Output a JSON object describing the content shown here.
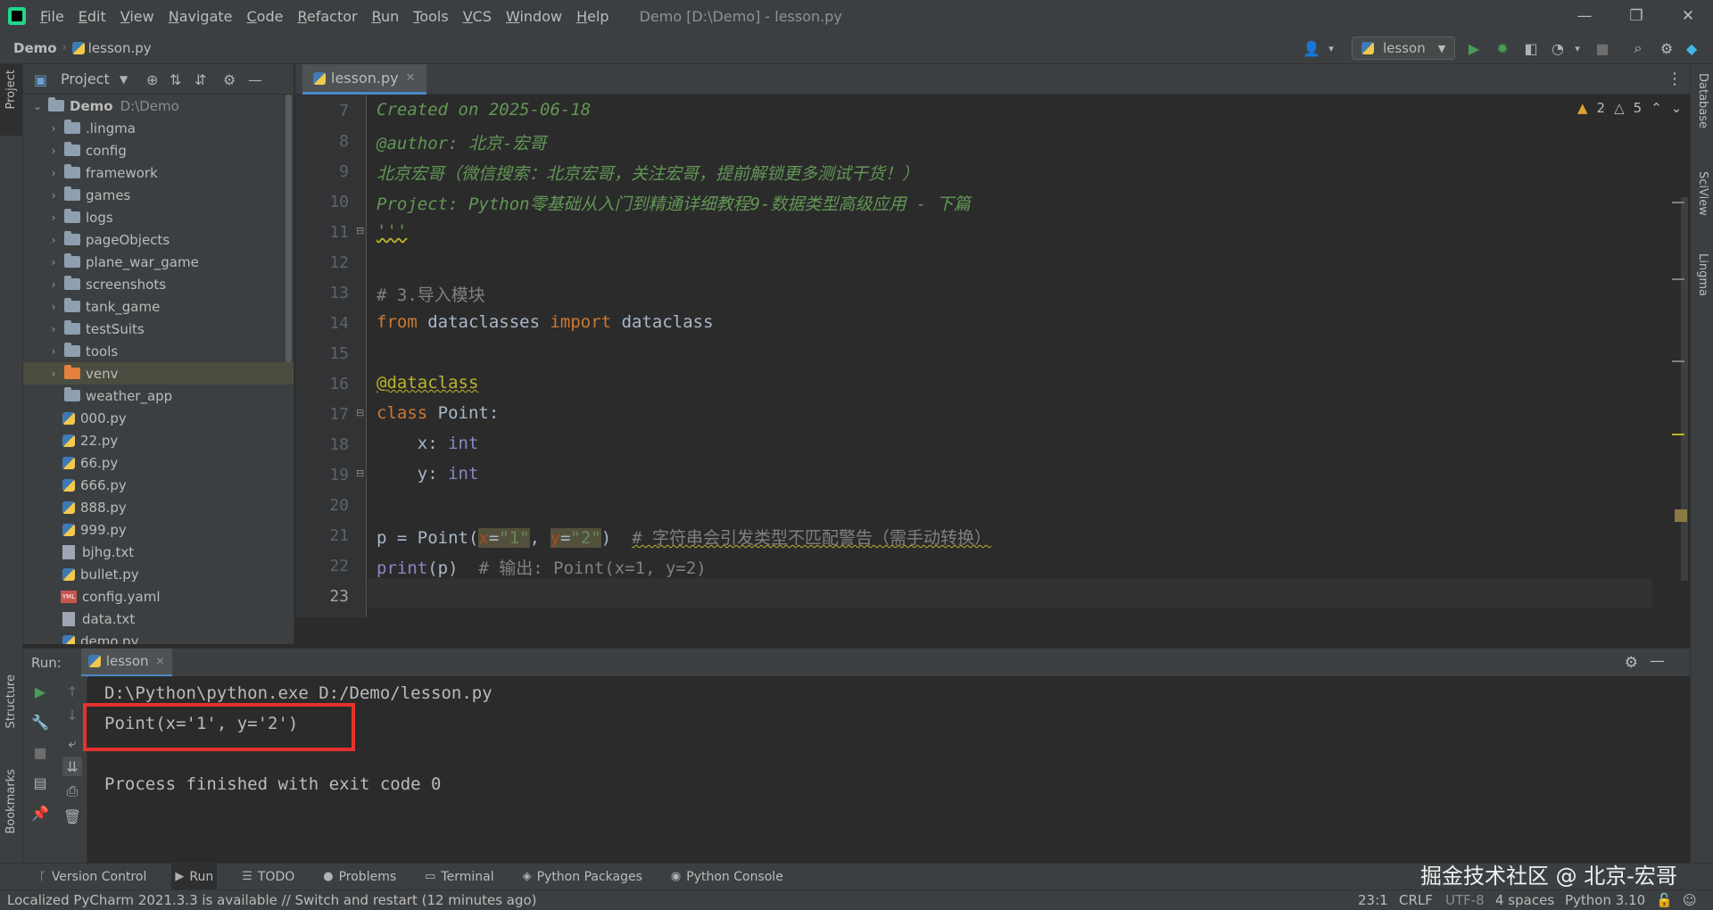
{
  "menubar": {
    "items": [
      "File",
      "Edit",
      "View",
      "Navigate",
      "Code",
      "Refactor",
      "Run",
      "Tools",
      "VCS",
      "Window",
      "Help"
    ],
    "title": "Demo [D:\\Demo] - lesson.py",
    "minimize": "—",
    "restore": "❐",
    "close": "✕"
  },
  "navbar": {
    "project": "Demo",
    "file": "lesson.py",
    "run_config": "lesson"
  },
  "project_panel": {
    "title": "Project",
    "root": {
      "name": "Demo",
      "path": "D:\\Demo"
    },
    "items": [
      {
        "name": ".lingma",
        "kind": "folder"
      },
      {
        "name": "config",
        "kind": "folder"
      },
      {
        "name": "framework",
        "kind": "folder"
      },
      {
        "name": "games",
        "kind": "folder"
      },
      {
        "name": "logs",
        "kind": "folder"
      },
      {
        "name": "pageObjects",
        "kind": "folder"
      },
      {
        "name": "plane_war_game",
        "kind": "folder"
      },
      {
        "name": "screenshots",
        "kind": "folder"
      },
      {
        "name": "tank_game",
        "kind": "folder"
      },
      {
        "name": "testSuits",
        "kind": "folder"
      },
      {
        "name": "tools",
        "kind": "folder"
      },
      {
        "name": "venv",
        "kind": "folder-excluded"
      },
      {
        "name": "weather_app",
        "kind": "folder"
      },
      {
        "name": "000.py",
        "kind": "python"
      },
      {
        "name": "22.py",
        "kind": "python"
      },
      {
        "name": "66.py",
        "kind": "python"
      },
      {
        "name": "666.py",
        "kind": "python"
      },
      {
        "name": "888.py",
        "kind": "python"
      },
      {
        "name": "999.py",
        "kind": "python"
      },
      {
        "name": "bjhg.txt",
        "kind": "text"
      },
      {
        "name": "bullet.py",
        "kind": "python"
      },
      {
        "name": "config.yaml",
        "kind": "yaml"
      },
      {
        "name": "data.txt",
        "kind": "text"
      },
      {
        "name": "demo.py",
        "kind": "python"
      }
    ]
  },
  "editor": {
    "tab": "lesson.py",
    "inspections": {
      "warnings": "2",
      "weak_warnings": "5"
    },
    "line_numbers": [
      "7",
      "8",
      "9",
      "10",
      "11",
      "12",
      "13",
      "14",
      "15",
      "16",
      "17",
      "18",
      "19",
      "20",
      "21",
      "22",
      "23"
    ],
    "lines": {
      "l7": "Created on 2025-06-18",
      "l8": "@author: 北京-宏哥",
      "l9": "北京宏哥（微信搜索：北京宏哥，关注宏哥，提前解锁更多测试干货！）",
      "l10": "Project: Python零基础从入门到精通详细教程9-数据类型高级应用 - 下篇",
      "l11": "'''",
      "l13": "# 3.导入模块",
      "l14_kw1": "from",
      "l14_mod": " dataclasses ",
      "l14_kw2": "import",
      "l14_name": " dataclass",
      "l16": "@dataclass",
      "l17_kw": "class",
      "l17_rest": " Point:",
      "l18_var": "    x: ",
      "l18_type": "int",
      "l19_var": "    y: ",
      "l19_type": "int",
      "l21_a": "p = Point(",
      "l21_x": "x",
      "l21_eq1": "=",
      "l21_s1": "\"1\"",
      "l21_comma": ", ",
      "l21_y": "y",
      "l21_eq2": "=",
      "l21_s2": "\"2\"",
      "l21_b": ")  ",
      "l21_cmt": "# 字符串会引发类型不匹配警告（需手动转换）",
      "l22_fn": "print",
      "l22_rest": "(p)  ",
      "l22_cmt": "# 输出: Point(x=1, y=2)"
    }
  },
  "run_window": {
    "label": "Run:",
    "tab": "lesson",
    "console": [
      "D:\\Python\\python.exe D:/Demo/lesson.py",
      "Point(x='1', y='2')",
      "",
      "Process finished with exit code 0"
    ]
  },
  "tool_tabs": [
    "Version Control",
    "Run",
    "TODO",
    "Problems",
    "Terminal",
    "Python Packages",
    "Python Console"
  ],
  "left_stripe": {
    "project": "Project",
    "structure": "Structure",
    "bookmarks": "Bookmarks"
  },
  "right_stripe": {
    "database": "Database",
    "sciview": "SciView",
    "lingma": "Lingma"
  },
  "statusbar": {
    "message": "Localized PyCharm 2021.3.3 is available // Switch and restart (12 minutes ago)",
    "position": "23:1",
    "line_sep": "CRLF",
    "encoding": "UTF-8",
    "indent": "4 spaces",
    "interpreter": "Python 3.10"
  },
  "watermark": "掘金技术社区 @ 北京-宏哥",
  "colors": {
    "accent": "#4a88c7",
    "highlight_box": "#e5322d",
    "run_green": "#499c54"
  }
}
